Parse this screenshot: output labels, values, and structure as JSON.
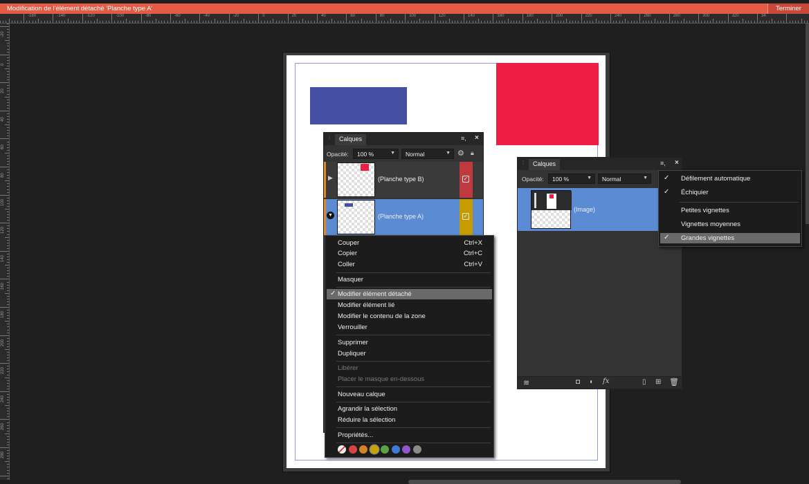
{
  "titlebar": {
    "title": "Modification de l'élément détaché 'Planche type A'",
    "done_label": "Terminer",
    "accent": "#e35a45"
  },
  "rulers": {
    "unit": "mm",
    "h_labels": [
      "-160",
      "-140",
      "-120",
      "-100",
      "-80",
      "-60",
      "-40",
      "-20",
      "0",
      "20",
      "40",
      "60",
      "80",
      "100",
      "120",
      "140",
      "160",
      "180",
      "200",
      "220",
      "240",
      "260",
      "280",
      "300",
      "320",
      "34"
    ],
    "v_labels": [
      "-20",
      "0",
      "20",
      "40",
      "60",
      "80",
      "100",
      "120",
      "140",
      "160",
      "180",
      "200",
      "220",
      "240",
      "260",
      "280",
      "300"
    ]
  },
  "canvas": {
    "blue_rect_color": "#4550a3",
    "red_rect_color": "#ef1c45"
  },
  "layers_panel_1": {
    "tab": "Calques",
    "menu_icon": "hamburger-icon",
    "close": "×",
    "opacity_label": "Opacité:",
    "opacity_value": "100 %",
    "blend_mode": "Normal",
    "layers": [
      {
        "name": "(Planche type B)",
        "color": "#c0393f"
      },
      {
        "name": "(Planche type A)",
        "color": "#c79a00"
      }
    ]
  },
  "context_menu": {
    "items": [
      {
        "label": "Couper",
        "shortcut": "Ctrl+X"
      },
      {
        "label": "Copier",
        "shortcut": "Ctrl+C"
      },
      {
        "label": "Coller",
        "shortcut": "Ctrl+V"
      },
      {
        "label": "Masquer",
        "shortcut": ""
      },
      {
        "label": "Modifier élément détaché",
        "shortcut": "",
        "checked": "✓"
      },
      {
        "label": "Modifier élément lié",
        "shortcut": ""
      },
      {
        "label": "Modifier le contenu de la zone",
        "shortcut": ""
      },
      {
        "label": "Verrouiller",
        "shortcut": ""
      },
      {
        "label": "Supprimer",
        "shortcut": ""
      },
      {
        "label": "Dupliquer",
        "shortcut": ""
      },
      {
        "label": "Libérer",
        "shortcut": ""
      },
      {
        "label": "Placer le masque en-dessous",
        "shortcut": ""
      },
      {
        "label": "Nouveau calque",
        "shortcut": ""
      },
      {
        "label": "Agrandir la sélection",
        "shortcut": ""
      },
      {
        "label": "Réduire la sélection",
        "shortcut": ""
      },
      {
        "label": "Propriétés...",
        "shortcut": ""
      }
    ],
    "swatches": [
      "#e8e8e8",
      "#d64545",
      "#d4822a",
      "#c9a400",
      "#5aa14a",
      "#3e7bd6",
      "#8e56c8",
      "#8a8a8a"
    ]
  },
  "layers_panel_2": {
    "tab": "Calques",
    "opacity_label": "Opacité:",
    "opacity_value": "100 %",
    "blend_mode": "Normal",
    "layer_name": "(Image)",
    "selected_color": "#5b8bd2"
  },
  "panel_menu": {
    "items": [
      {
        "label": "Défilement automatique",
        "checked": "✓"
      },
      {
        "label": "Échiquier",
        "checked": "✓"
      },
      {
        "label": "Petites vignettes",
        "checked": ""
      },
      {
        "label": "Vignettes moyennes",
        "checked": ""
      },
      {
        "label": "Grandes vignettes",
        "checked": "✓"
      }
    ]
  },
  "footer_icons": [
    "layers-icon",
    "mask-icon",
    "adjustment-icon",
    "fx-icon",
    "new-layer-icon",
    "group-icon",
    "trash-icon"
  ]
}
